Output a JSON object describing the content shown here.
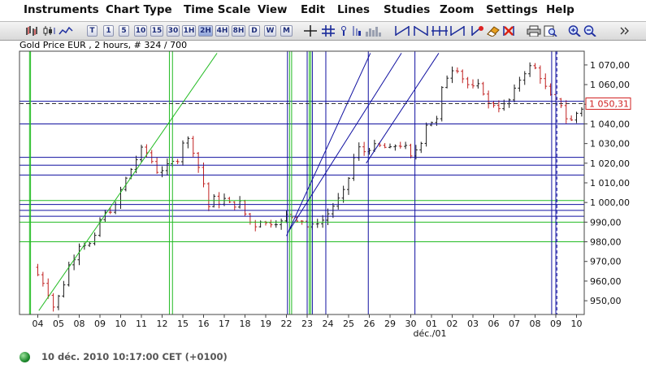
{
  "menu": {
    "instruments": "Instruments",
    "chart_type": "Chart Type",
    "time_scale": "Time Scale",
    "view": "View",
    "edit": "Edit",
    "lines": "Lines",
    "studies": "Studies",
    "zoom": "Zoom",
    "settings": "Settings",
    "help": "Help"
  },
  "toolbar": {
    "timeframes": [
      "T",
      "1",
      "5",
      "10",
      "15",
      "30",
      "1H",
      "2H",
      "4H",
      "8H",
      "D",
      "W",
      "M"
    ],
    "active_timeframe": "2H"
  },
  "chart_title": "Gold Price EUR , 2 hours, # 324 / 700",
  "status": {
    "text": "10 déc. 2010 10:17:00  CET (+0100)",
    "color": "#1f8a2e"
  },
  "chart_data": {
    "type": "bar",
    "instrument": "Gold Price EUR",
    "ylim": [
      943,
      1077
    ],
    "y_ticks": [
      950,
      960,
      970,
      980,
      990,
      1000,
      1010,
      1020,
      1030,
      1040,
      1050,
      1060,
      1070
    ],
    "y_tick_labels": [
      "950,00",
      "960,00",
      "970,00",
      "980,00",
      "990,00",
      "1 000,00",
      "1 010,00",
      "1 020,00",
      "1 030,00",
      "1 040,00",
      "1 050,00",
      "1 060,00",
      "1 070,00"
    ],
    "x_tick_labels": [
      "04",
      "05",
      "08",
      "09",
      "10",
      "11",
      "12",
      "15",
      "16",
      "17",
      "18",
      "19",
      "22",
      "23",
      "24",
      "25",
      "26",
      "29",
      "30",
      "01",
      "02",
      "03",
      "06",
      "07",
      "08",
      "09",
      "10"
    ],
    "x_axis_label": "déc./01",
    "current_price": 1050.31,
    "current_price_label": "1 050,31",
    "price_path": [
      [
        0.0,
        967
      ],
      [
        0.6,
        958
      ],
      [
        1.0,
        947
      ],
      [
        1.4,
        955
      ],
      [
        1.8,
        970
      ],
      [
        2.0,
        972
      ],
      [
        2.3,
        980
      ],
      [
        2.7,
        978
      ],
      [
        3.0,
        982
      ],
      [
        3.3,
        993
      ],
      [
        3.6,
        995
      ],
      [
        4.0,
        998
      ],
      [
        4.3,
        1008
      ],
      [
        4.7,
        1016
      ],
      [
        5.0,
        1022
      ],
      [
        5.3,
        1028
      ],
      [
        5.6,
        1024
      ],
      [
        6.0,
        1016
      ],
      [
        6.3,
        1017
      ],
      [
        6.7,
        1020
      ],
      [
        7.0,
        1022
      ],
      [
        7.2,
        1030
      ],
      [
        7.4,
        1034
      ],
      [
        7.7,
        1028
      ],
      [
        8.0,
        1018
      ],
      [
        8.3,
        1008
      ],
      [
        8.5,
        998
      ],
      [
        8.8,
        1003
      ],
      [
        9.0,
        1000
      ],
      [
        9.3,
        1002
      ],
      [
        9.6,
        998
      ],
      [
        10.0,
        1000
      ],
      [
        10.2,
        995
      ],
      [
        10.5,
        990
      ],
      [
        10.8,
        988
      ],
      [
        11.0,
        991
      ],
      [
        11.3,
        989
      ],
      [
        11.6,
        990
      ],
      [
        12.0,
        990
      ],
      [
        12.3,
        994
      ],
      [
        12.6,
        992
      ],
      [
        13.0,
        991
      ],
      [
        13.2,
        988
      ],
      [
        13.4,
        987
      ],
      [
        13.7,
        990
      ],
      [
        14.0,
        991
      ],
      [
        14.3,
        995
      ],
      [
        14.6,
        1000
      ],
      [
        14.9,
        1003
      ],
      [
        15.2,
        1010
      ],
      [
        15.4,
        1020
      ],
      [
        15.7,
        1028
      ],
      [
        16.0,
        1026
      ],
      [
        16.3,
        1028
      ],
      [
        16.6,
        1029
      ],
      [
        17.0,
        1028
      ],
      [
        17.3,
        1027
      ],
      [
        17.6,
        1030
      ],
      [
        18.0,
        1028
      ],
      [
        18.2,
        1022
      ],
      [
        18.5,
        1027
      ],
      [
        18.8,
        1032
      ],
      [
        19.0,
        1040
      ],
      [
        19.2,
        1041
      ],
      [
        19.5,
        1042
      ],
      [
        19.7,
        1056
      ],
      [
        19.9,
        1062
      ],
      [
        20.1,
        1066
      ],
      [
        20.4,
        1070
      ],
      [
        20.7,
        1064
      ],
      [
        21.0,
        1060
      ],
      [
        21.3,
        1058
      ],
      [
        21.6,
        1060
      ],
      [
        22.0,
        1050
      ],
      [
        22.3,
        1050
      ],
      [
        22.6,
        1048
      ],
      [
        23.0,
        1052
      ],
      [
        23.3,
        1058
      ],
      [
        23.6,
        1065
      ],
      [
        24.0,
        1069
      ],
      [
        24.3,
        1068
      ],
      [
        24.6,
        1062
      ],
      [
        24.9,
        1055
      ],
      [
        25.2,
        1052
      ],
      [
        25.5,
        1050
      ],
      [
        25.7,
        1044
      ],
      [
        25.9,
        1040
      ],
      [
        26.2,
        1045
      ],
      [
        26.5,
        1048
      ],
      [
        26.8,
        1050
      ],
      [
        27.0,
        1052
      ],
      [
        27.4,
        1050
      ]
    ],
    "annotation_lines": {
      "green_verticals": [
        0.15,
        0.2,
        6.9,
        7.05,
        12.7,
        12.8,
        13.65,
        13.72
      ],
      "blue_verticals": [
        12.6,
        13.55,
        13.8,
        14.45,
        16.5,
        18.75,
        25.35,
        25.55
      ],
      "blue_dashed_verticals": [
        25.6
      ],
      "blue_horizontals": [
        1051.5,
        1040,
        1023,
        1019,
        1014,
        999,
        996,
        993
      ],
      "green_horizontals": [
        1001,
        990,
        980
      ],
      "green_trend": [
        [
          0.6,
          945
        ],
        [
          9.2,
          1076
        ]
      ],
      "blue_trends": [
        [
          [
            12.55,
            983
          ],
          [
            16.6,
            1076
          ]
        ],
        [
          [
            12.7,
            986
          ],
          [
            18.1,
            1076
          ]
        ],
        [
          [
            16.4,
            1020
          ],
          [
            19.9,
            1076
          ]
        ]
      ]
    }
  }
}
